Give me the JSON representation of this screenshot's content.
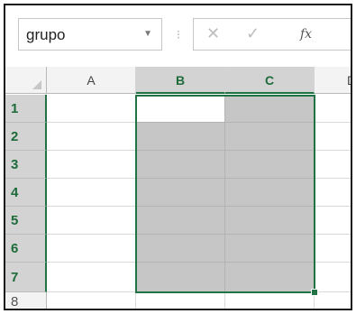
{
  "namebox": {
    "value": "grupo",
    "icon": "chevron-down-icon"
  },
  "formula_bar": {
    "cancel_icon": "close-icon",
    "enter_icon": "check-icon",
    "function_label": "fx",
    "separator": "⁝"
  },
  "columns": [
    {
      "label": "A",
      "selected": false
    },
    {
      "label": "B",
      "selected": true
    },
    {
      "label": "C",
      "selected": true
    },
    {
      "label": "D",
      "selected": false
    }
  ],
  "rows": [
    {
      "label": "1",
      "selected": true
    },
    {
      "label": "2",
      "selected": true
    },
    {
      "label": "3",
      "selected": true
    },
    {
      "label": "4",
      "selected": true
    },
    {
      "label": "5",
      "selected": true
    },
    {
      "label": "6",
      "selected": true
    },
    {
      "label": "7",
      "selected": true
    },
    {
      "label": "8",
      "selected": false
    }
  ],
  "selection": {
    "range": "B1:C7",
    "active_cell": "B1"
  },
  "colors": {
    "accent": "#217346",
    "selection_fill": "#c6c6c6",
    "header_selected": "#d3d3d3"
  }
}
